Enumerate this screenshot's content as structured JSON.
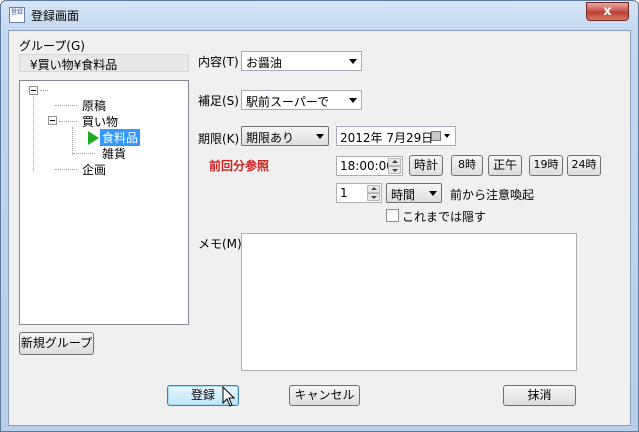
{
  "window": {
    "title": "登録画面",
    "close_glyph": "x",
    "icon_text": "登録"
  },
  "group": {
    "label": "グループ(G)",
    "path": "¥買い物¥食料品",
    "tree": [
      {
        "label": "原稿"
      },
      {
        "label": "買い物"
      },
      {
        "label": "食料品",
        "selected": true
      },
      {
        "label": "雑貨"
      },
      {
        "label": "企画"
      }
    ],
    "new_group_button": "新規グループ"
  },
  "fields": {
    "content_label": "内容(T)",
    "content_value": "お醤油",
    "supplement_label": "補足(S)",
    "supplement_value": "駅前スーパーで",
    "deadline_label": "期限(K)",
    "deadline_value": "期限あり",
    "date_value": "2012年  7月29日",
    "previous_ref": "前回分参照",
    "time_value": "18:00:00",
    "time_buttons": [
      "時計",
      "8時",
      "正午",
      "19時",
      "24時"
    ],
    "remind_count": "1",
    "remind_unit": "時間",
    "remind_suffix": "前から注意喚起",
    "hide_until_label": "これまでは隠す",
    "memo_label": "メモ(M)"
  },
  "buttons": {
    "register": "登録",
    "cancel": "キャンセル",
    "delete": "抹消"
  },
  "colors": {
    "accent_red": "#cc2222",
    "selection": "#3399ff",
    "arrow_green": "#22aa22"
  }
}
